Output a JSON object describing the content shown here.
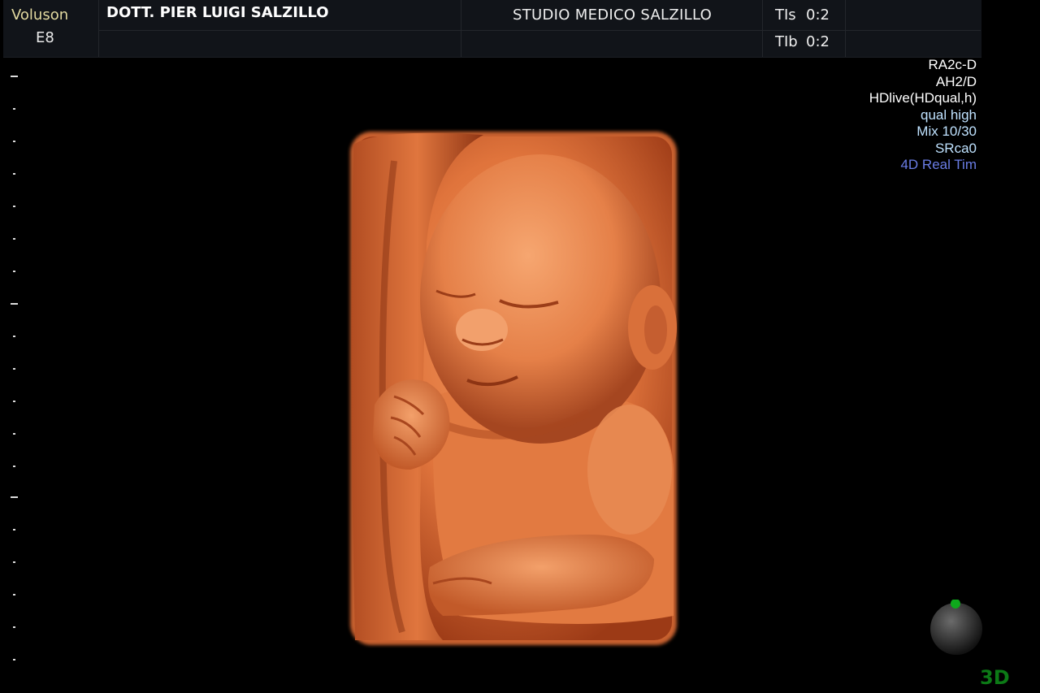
{
  "header": {
    "brand_line1": "Voluson",
    "brand_line2": "E8",
    "doctor": "DOTT. PIER LUIGI SALZILLO",
    "studio": "STUDIO MEDICO SALZILLO",
    "tis_label": "TIs",
    "tis_value": "0:2",
    "tib_label": "TIb",
    "tib_value": "0:2"
  },
  "info_panel": {
    "probe": "RA2c-D",
    "preset": "AH2/D",
    "render_mode": "HDlive(HDqual,h)",
    "quality": "qual high",
    "mix": "Mix 10/30",
    "srca": "SRca0",
    "mode": "4D Real Tim"
  },
  "colors": {
    "brand": "#e2d9a0",
    "white_text": "#ffffff",
    "cyan_text": "#bfe2ff",
    "blue_text": "#6a7de6",
    "mode_3d": "#0c7a16",
    "skin": "#e4783f"
  },
  "mode_label": "3D",
  "render": {
    "icon": "fetal-3d-render"
  },
  "orientation": {
    "icon": "orientation-sphere-icon"
  }
}
